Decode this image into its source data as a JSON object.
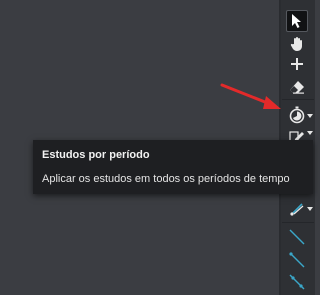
{
  "colors": {
    "canvas": "#3b3d42",
    "toolbar": "#2e3034",
    "tooltip": "#1e1f22",
    "annotation_arrow": "#e32a2a",
    "line_tool": "#3aa7c9"
  },
  "toolbar": {
    "tools": [
      {
        "icon": "cursor-arrow-icon",
        "active": true
      },
      {
        "icon": "hand-pan-icon"
      },
      {
        "icon": "crosshair-plus-icon"
      },
      {
        "icon": "eraser-icon"
      },
      {
        "icon": "stopwatch-period-icon",
        "has_dropdown": true
      },
      {
        "icon": "pencil-icon",
        "has_dropdown": true
      },
      {
        "icon": "brush-icon",
        "has_dropdown": true
      },
      {
        "icon": "trend-line-icon"
      },
      {
        "icon": "ray-line-icon"
      },
      {
        "icon": "extended-line-icon"
      }
    ]
  },
  "tooltip": {
    "title": "Estudos por período",
    "description": "Aplicar os estudos em todos os períodos de tempo"
  }
}
